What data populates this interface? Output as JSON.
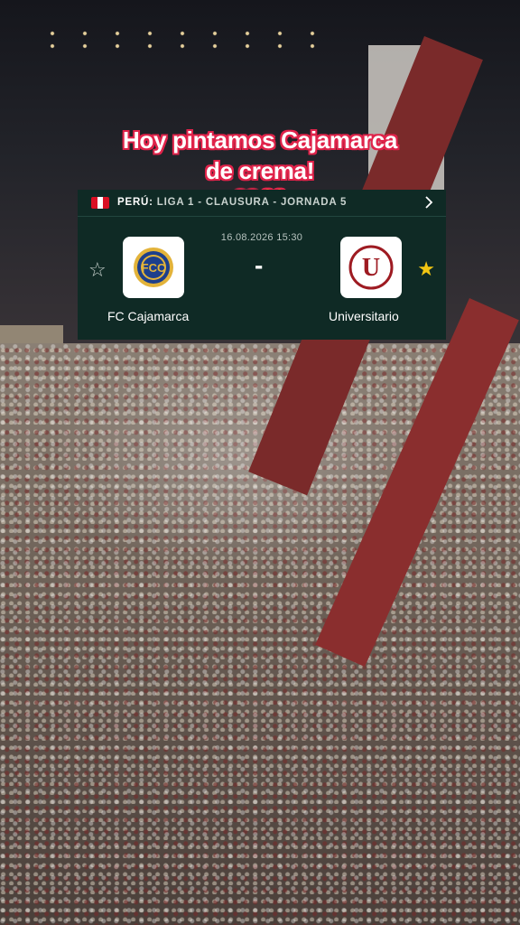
{
  "caption": {
    "line1": "Hoy pintamos Cajamarca",
    "line2": "de crema!",
    "emojis": "💗💛"
  },
  "match": {
    "country": "PERÚ:",
    "competition": "LIGA 1 - CLAUSURA - JORNADA 5",
    "datetime": "16.08.2026 15:30",
    "score_separator": "-",
    "home": {
      "name": "FC Cajamarca",
      "crest_text": "FCC",
      "favorite": false
    },
    "away": {
      "name": "Universitario",
      "crest_text": "U",
      "favorite": true
    }
  },
  "colors": {
    "card_bg": "#0f2a25",
    "caption_outline": "#e0234a",
    "star_active": "#f3c612",
    "universitario_red": "#9e1b22",
    "cajamarca_blue": "#1d3f8c",
    "cajamarca_gold": "#e3b33a"
  },
  "icons": [
    "peru-flag-icon",
    "chevron-right-icon",
    "star-outline-icon",
    "star-filled-icon"
  ]
}
